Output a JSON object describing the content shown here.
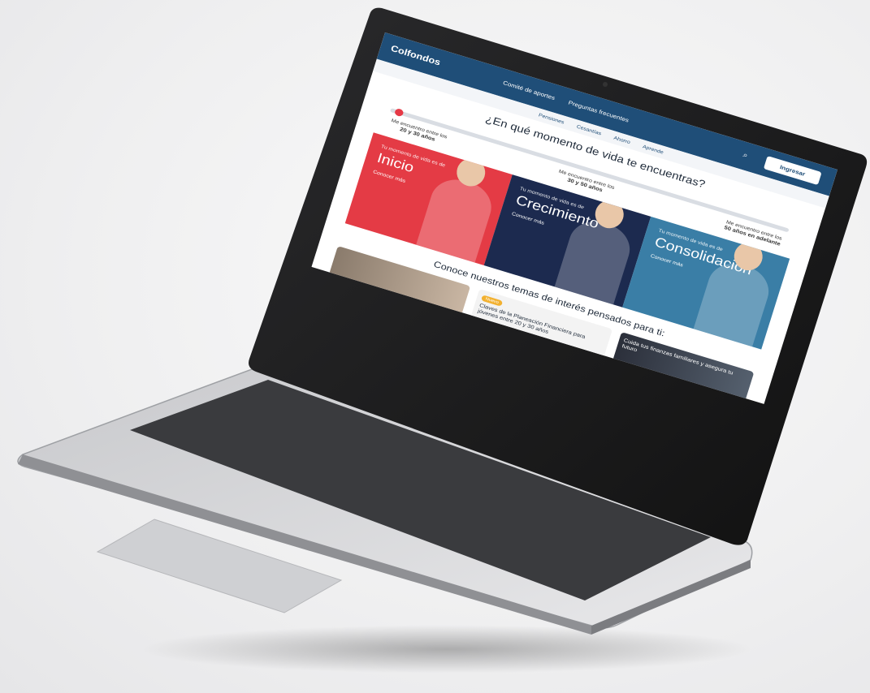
{
  "site": {
    "logo_brand": "Colfondos",
    "nav_links": [
      "Comité de aportes",
      "Preguntas frecuentes"
    ],
    "login_label": "Ingresar",
    "subnav": [
      "Pensiones",
      "Cesantías",
      "Ahorro",
      "Aprende"
    ],
    "heading": "¿En qué momento de vida te encuentras?",
    "steps": [
      {
        "small": "Me encuentro entre los",
        "big": "20 y 30 años"
      },
      {
        "small": "Me encuentro entre los",
        "big": "30 y 50 años"
      },
      {
        "small": "Me encuentro entre los",
        "big": "50 años en adelante"
      }
    ],
    "cards": [
      {
        "small": "Tu momento de vida es de",
        "big": "Inicio",
        "more": "Conocer más"
      },
      {
        "small": "Tu momento de vida es de",
        "big": "Crecimiento",
        "more": "Conocer más"
      },
      {
        "small": "Tu momento de vida es de",
        "big": "Consolidación",
        "more": "Conocer más"
      }
    ],
    "themes_title": "Conoce nuestros temas de interés pensados para ti:",
    "theme_cards": [
      {
        "tag": "Nuevo",
        "title": "Claves de la Planeación Financiera para jóvenes entre 20 y 30 años"
      },
      {
        "tag": "",
        "title": "Cuida tus finanzas familiares y asegura tu futuro"
      }
    ]
  }
}
